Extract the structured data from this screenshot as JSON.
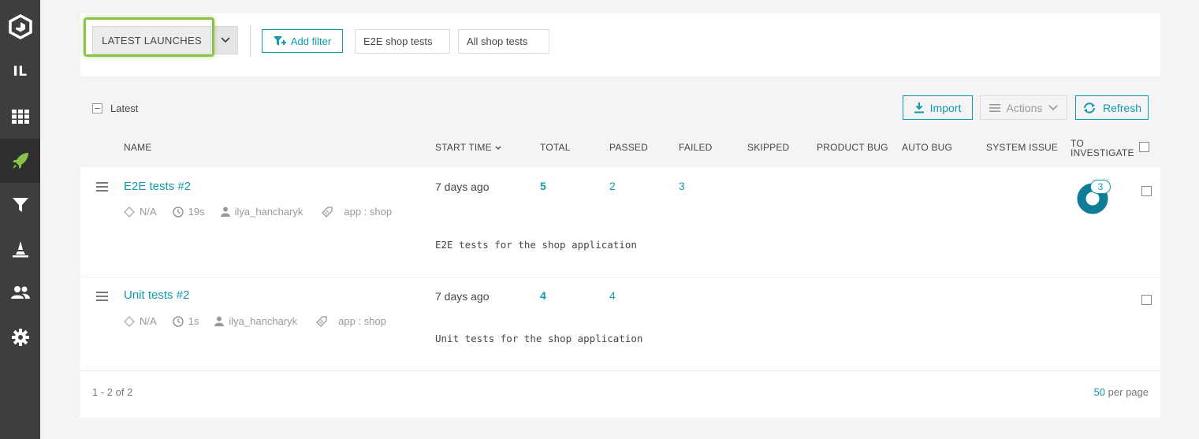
{
  "sidebar": {
    "project_initials": "IL",
    "items": [
      {
        "icon": "logo-icon"
      },
      {
        "icon": "project-icon"
      },
      {
        "icon": "dashboard-grid-icon"
      },
      {
        "icon": "launches-rocket-icon",
        "active": true
      },
      {
        "icon": "filter-icon"
      },
      {
        "icon": "debug-icon"
      },
      {
        "icon": "members-icon"
      },
      {
        "icon": "settings-gear-icon"
      }
    ]
  },
  "filters": {
    "launch_mode": "LATEST LAUNCHES",
    "add_filter": "Add filter",
    "saved": [
      "E2E shop tests",
      "All shop tests"
    ]
  },
  "toolbar": {
    "latest_label": "Latest",
    "import": "Import",
    "actions": "Actions",
    "refresh": "Refresh"
  },
  "columns": {
    "name": "NAME",
    "start_time": "START TIME",
    "total": "TOTAL",
    "passed": "PASSED",
    "failed": "FAILED",
    "skipped": "SKIPPED",
    "product_bug": "PRODUCT BUG",
    "auto_bug": "AUTO BUG",
    "system_issue": "SYSTEM ISSUE",
    "to_investigate_1": "TO",
    "to_investigate_2": "INVESTIGATE"
  },
  "rows": [
    {
      "name": "E2E tests #2",
      "defect": "N/A",
      "duration": "19s",
      "owner": "ilya_hancharyk",
      "attribute": "app : shop",
      "start_time": "7 days ago",
      "total": "5",
      "passed": "2",
      "failed": "3",
      "to_investigate": "3",
      "description": "E2E tests for the shop application"
    },
    {
      "name": "Unit tests #2",
      "defect": "N/A",
      "duration": "1s",
      "owner": "ilya_hancharyk",
      "attribute": "app : shop",
      "start_time": "7 days ago",
      "total": "4",
      "passed": "4",
      "description": "Unit tests for the shop application"
    }
  ],
  "pager": {
    "range": "1 - 2 of 2",
    "per_page_value": "50",
    "per_page_label": "per page"
  },
  "colors": {
    "accent": "#0f9bad",
    "sidebar": "#3e3e3e",
    "highlight": "#8bc34a",
    "active_icon": "#8bc34a"
  }
}
